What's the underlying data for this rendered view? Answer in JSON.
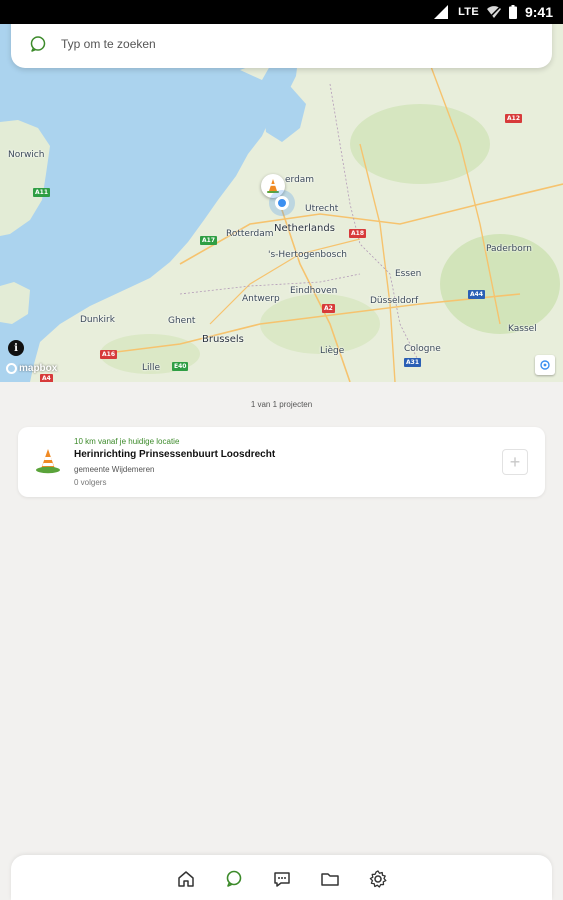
{
  "status_bar": {
    "network": "LTE",
    "time": "9:41"
  },
  "search": {
    "placeholder": "Typ om te zoeken",
    "icon": "search-icon"
  },
  "map": {
    "labels": {
      "amsterdam": "erdam",
      "netherlands": "Netherlands",
      "brussels": "Brussels",
      "dusseldorf": "Düsseldorf",
      "hertogenbosch": "'s-Hertogenbosch",
      "dunkirk": "Dunkirk",
      "ghent": "Ghent",
      "lille": "Lille",
      "cologne": "Cologne",
      "norwich": "Norwich",
      "rotterdam": "Rotterdam",
      "antwerp": "Antwerp",
      "utrecht": "Utrecht",
      "eindhoven": "Eindhoven",
      "liege": "Liège",
      "paderborn": "Paderborn",
      "kassel": "Kassel",
      "essen": "Essen"
    },
    "shields": {
      "a31": "A31",
      "a18": "A18",
      "a2": "A2",
      "e40": "E40",
      "a16": "A16",
      "a4": "A4",
      "a44": "A44",
      "m11": "A11",
      "a12": "A12",
      "a17": "A17"
    },
    "attribution": "mapbox",
    "info_button": "i",
    "colors": {
      "water": "#abd3ee",
      "land": "#e8eedb",
      "forest": "#cfe3b5",
      "road": "#f6c36e"
    }
  },
  "results": {
    "count_text": "1 van 1 projecten",
    "items": [
      {
        "distance": "10 km vanaf je huidige locatie",
        "title": "Herinrichting Prinsessenbuurt Loosdrecht",
        "organization": "gemeente Wijdemeren",
        "followers": "0 volgers",
        "follow_label": "+",
        "icon": "traffic-cone-icon"
      }
    ]
  },
  "bottom_nav": {
    "items": [
      {
        "name": "home",
        "icon": "home-icon"
      },
      {
        "name": "search",
        "icon": "search-icon",
        "active": true
      },
      {
        "name": "messages",
        "icon": "chat-icon"
      },
      {
        "name": "projects",
        "icon": "folder-icon"
      },
      {
        "name": "settings",
        "icon": "gear-icon"
      }
    ],
    "active_color": "#3c8a2a"
  }
}
